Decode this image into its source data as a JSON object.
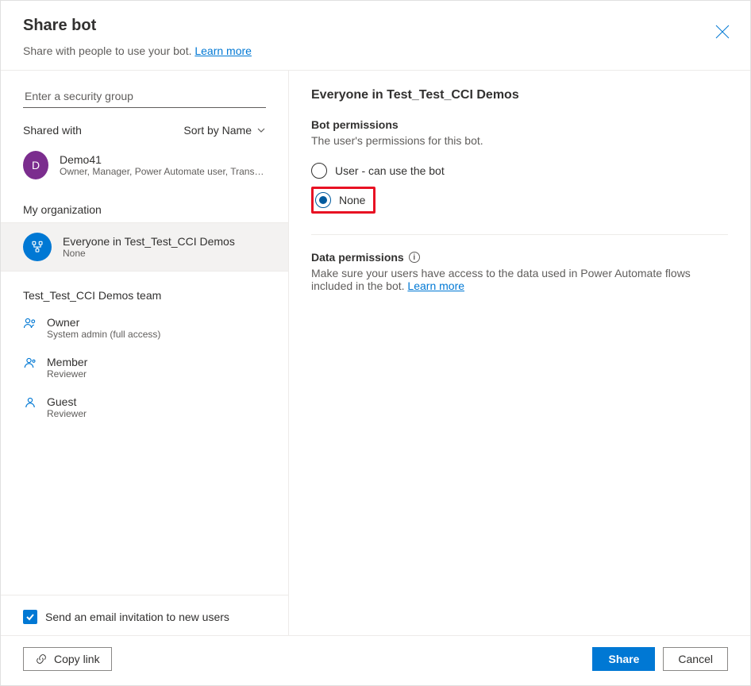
{
  "header": {
    "title": "Share bot",
    "subtitle_text": "Share with people to use your bot. ",
    "subtitle_link": "Learn more"
  },
  "left": {
    "search_placeholder": "Enter a security group",
    "shared_with_label": "Shared with",
    "sort_label": "Sort by Name",
    "user": {
      "initial": "D",
      "name": "Demo41",
      "roles": "Owner, Manager, Power Automate user, Transc..."
    },
    "org_section": "My organization",
    "org_item": {
      "name": "Everyone in Test_Test_CCI Demos",
      "perm": "None"
    },
    "team_section": "Test_Test_CCI Demos team",
    "roles": [
      {
        "name": "Owner",
        "desc": "System admin (full access)"
      },
      {
        "name": "Member",
        "desc": "Reviewer"
      },
      {
        "name": "Guest",
        "desc": "Reviewer"
      }
    ],
    "email_invite_label": "Send an email invitation to new users"
  },
  "right": {
    "heading": "Everyone in Test_Test_CCI Demos",
    "bot_perms_title": "Bot permissions",
    "bot_perms_desc": "The user's permissions for this bot.",
    "option_user": "User - can use the bot",
    "option_none": "None",
    "data_perms_title": "Data permissions",
    "data_perms_desc_pre": "Make sure your users have access to the data used in Power Automate flows included in the bot. ",
    "data_perms_link": "Learn more"
  },
  "footer": {
    "copy_link": "Copy link",
    "share": "Share",
    "cancel": "Cancel"
  }
}
